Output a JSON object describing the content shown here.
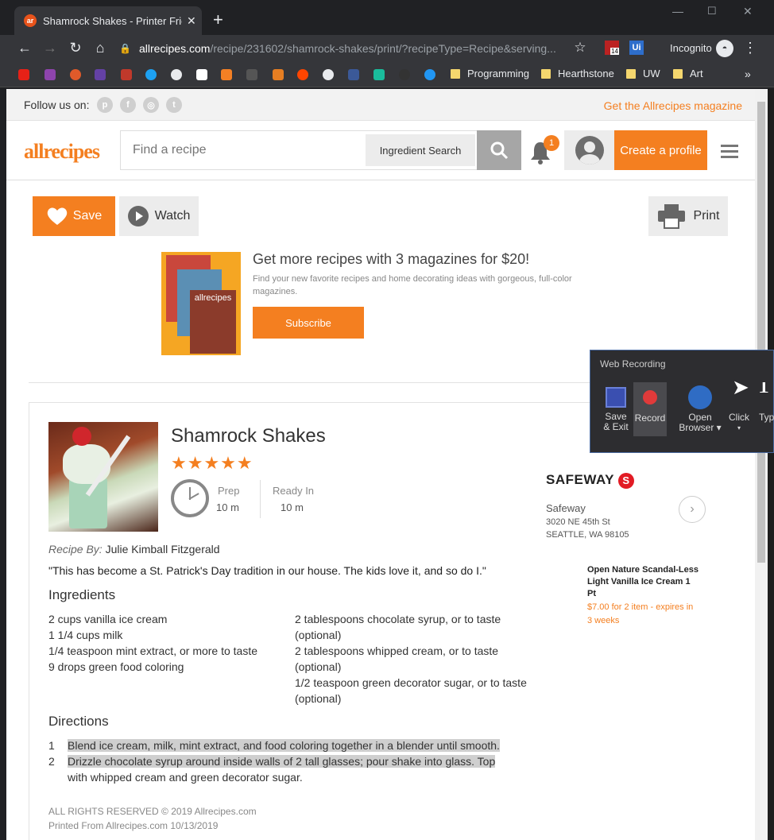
{
  "browser": {
    "tab_title": "Shamrock Shakes - Printer Friendly",
    "tab_favicon": "ar",
    "url_domain": "allrecipes.com",
    "url_path": "/recipe/231602/shamrock-shakes/print/?recipeType=Recipe&serving...",
    "incognito_label": "Incognito",
    "ext_badge": "14",
    "ext_ui": "Ui"
  },
  "bookmarks": {
    "folders": [
      "Programming",
      "Hearthstone",
      "UW",
      "Art"
    ],
    "more": "»"
  },
  "site": {
    "follow_label": "Follow us on:",
    "magazine_link": "Get the Allrecipes magazine",
    "logo": "allrecipes",
    "search_placeholder": "Find a recipe",
    "ingredient_search": "Ingredient Search",
    "notification_count": "1",
    "create_profile": "Create a profile"
  },
  "actions": {
    "save": "Save",
    "watch": "Watch",
    "print": "Print"
  },
  "promo": {
    "cover_text": "allrecipes",
    "title": "Get more recipes with 3 magazines for $20!",
    "description": "Find your new favorite recipes and home decorating ideas with gorgeous, full-color magazines.",
    "subscribe": "Subscribe"
  },
  "recipe": {
    "title": "Shamrock Shakes",
    "stars": "★★★★★",
    "prep_label": "Prep",
    "prep_value": "10 m",
    "ready_label": "Ready In",
    "ready_value": "10 m",
    "recipe_by_label": "Recipe By:",
    "author": "Julie Kimball Fitzgerald",
    "quote": "\"This has become a St. Patrick's Day tradition in our house. The kids love it, and so do I.\"",
    "ingredients_heading": "Ingredients",
    "ingredients_left": [
      "2 cups vanilla ice cream",
      "1 1/4 cups milk",
      "1/4 teaspoon mint extract, or more to taste",
      "9 drops green food coloring"
    ],
    "ingredients_right": [
      "2 tablespoons chocolate syrup, or to taste (optional)",
      "2 tablespoons whipped cream, or to taste (optional)",
      "1/2 teaspoon green decorator sugar, or to taste (optional)"
    ],
    "directions_heading": "Directions",
    "directions": [
      {
        "n": "1",
        "text": "Blend ice cream, milk, mint extract, and food coloring together in a blender until smooth."
      },
      {
        "n": "2",
        "text": "Drizzle chocolate syrup around inside walls of 2 tall glasses; pour shake into glass. Top",
        "text2": "with whipped cream and green decorator sugar."
      }
    ],
    "copyright": "ALL RIGHTS RESERVED © 2019 Allrecipes.com",
    "printed": "Printed From Allrecipes.com 10/13/2019"
  },
  "store": {
    "brand": "SAFEWAY",
    "brand_mark": "S",
    "name": "Safeway",
    "address1": "3020 NE 45th St",
    "address2": "SEATTLE, WA 98105",
    "product": "Open Nature Scandal-Less Light Vanilla Ice Cream 1 Pt",
    "price": "$7.00 for 2 item - expires in 3 weeks"
  },
  "web_recording": {
    "title": "Web Recording",
    "save_exit_1": "Save",
    "save_exit_2": "& Exit",
    "record": "Record",
    "open_browser_1": "Open",
    "open_browser_2": "Browser ▾",
    "click": "Click",
    "click_arrow": "▾",
    "type": "Typ"
  }
}
